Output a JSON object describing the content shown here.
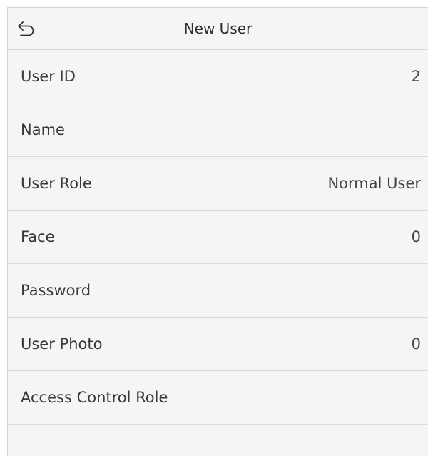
{
  "header": {
    "title": "New User",
    "back_icon": "back-arrow-icon"
  },
  "fields": [
    {
      "label": "User ID",
      "value": "2"
    },
    {
      "label": "Name",
      "value": ""
    },
    {
      "label": "User Role",
      "value": "Normal User"
    },
    {
      "label": "Face",
      "value": "0"
    },
    {
      "label": "Password",
      "value": ""
    },
    {
      "label": "User Photo",
      "value": "0"
    },
    {
      "label": "Access Control Role",
      "value": ""
    }
  ]
}
